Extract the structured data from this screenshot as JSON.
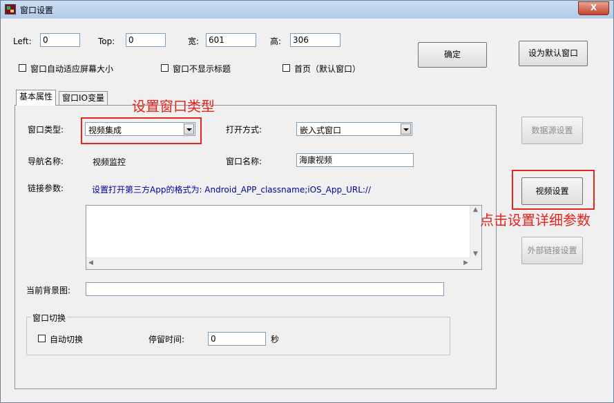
{
  "window": {
    "title": "窗口设置",
    "close_label": "X"
  },
  "position": {
    "left_label": "Left:",
    "left_value": "0",
    "top_label": "Top:",
    "top_value": "0",
    "width_label": "宽:",
    "width_value": "601",
    "height_label": "高:",
    "height_value": "306"
  },
  "options": {
    "auto_fit_label": "窗口自动适应屏幕大小",
    "hide_title_label": "窗口不显示标题",
    "home_label": "首页（默认窗口）"
  },
  "buttons": {
    "ok": "确定",
    "set_default": "设为默认窗口",
    "datasource": "数据源设置",
    "video": "视频设置",
    "external_link": "外部链接设置"
  },
  "tabs": [
    {
      "label": "基本属性"
    },
    {
      "label": "窗口IO变量"
    }
  ],
  "basic": {
    "window_type_label": "窗口类型:",
    "window_type_value": "视频集成",
    "open_mode_label": "打开方式:",
    "open_mode_value": "嵌入式窗口",
    "nav_name_label": "导航名称:",
    "nav_name_value": "视频监控",
    "window_name_label": "窗口名称:",
    "window_name_value": "海康视频",
    "link_params_label": "链接参数:",
    "link_hint": "设置打开第三方App的格式为: Android_APP_classname;iOS_App_URL://",
    "bg_image_label": "当前背景图:",
    "bg_image_value": ""
  },
  "switch_group": {
    "title": "窗口切换",
    "auto_switch_label": "自动切换",
    "stay_time_label": "停留时间:",
    "stay_time_value": "0",
    "unit": "秒"
  },
  "annotations": {
    "window_type_note": "设置窗口类型",
    "video_note": "点击设置详细参数",
    "color": "#e8231e"
  }
}
